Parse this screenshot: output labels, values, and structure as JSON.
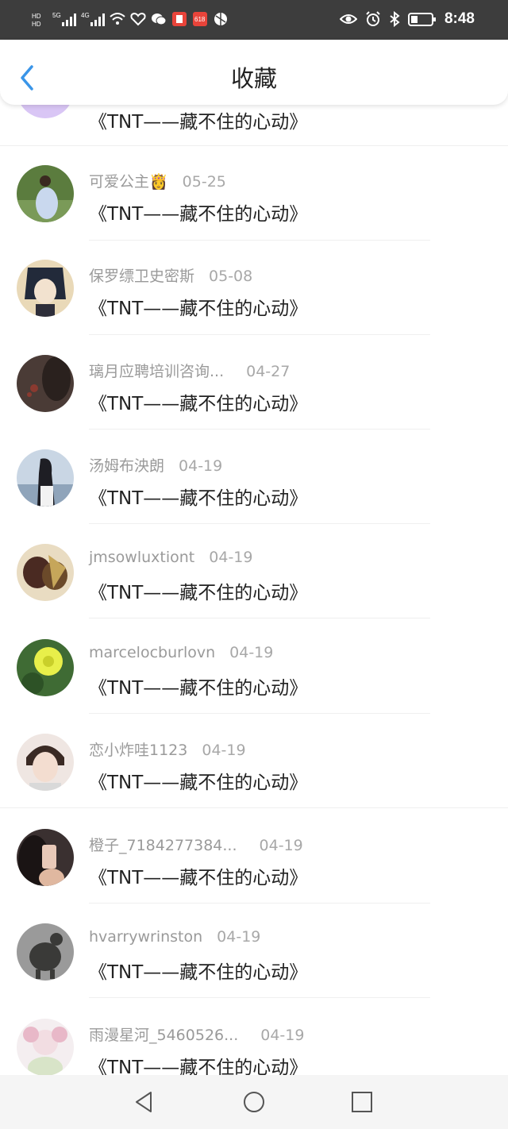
{
  "status_bar": {
    "time": "8:48",
    "left_icons": [
      "hd-icon",
      "5g-signal-icon",
      "4g-signal-icon",
      "wifi-icon",
      "health-icon",
      "wechat-icon",
      "red-app-icon",
      "618-app-icon",
      "ball-app-icon"
    ],
    "right_icons": [
      "eye-icon",
      "alarm-icon",
      "bluetooth-icon",
      "battery-icon"
    ]
  },
  "header": {
    "title": "收藏",
    "back_icon": "chevron-left-icon",
    "accent_color": "#3a95e8"
  },
  "favorites": {
    "partial_top_message": "《TNT——藏不住的心动》",
    "items": [
      {
        "name": "可爱公主👸",
        "date": "05-25",
        "message": "《TNT——藏不住的心动》"
      },
      {
        "name": "保罗缥卫史密斯",
        "date": "05-08",
        "message": "《TNT——藏不住的心动》"
      },
      {
        "name": "璃月应聘培训咨询...",
        "date": "04-27",
        "message": "《TNT——藏不住的心动》"
      },
      {
        "name": "汤姆布泱朗",
        "date": "04-19",
        "message": "《TNT——藏不住的心动》"
      },
      {
        "name": "jmsowluxtiont",
        "date": "04-19",
        "message": "《TNT——藏不住的心动》"
      },
      {
        "name": "marcelocburlovn",
        "date": "04-19",
        "message": "《TNT——藏不住的心动》"
      },
      {
        "name": "恋小炸哇1123",
        "date": "04-19",
        "message": "《TNT——藏不住的心动》"
      },
      {
        "name": "橙子_7184277384...",
        "date": "04-19",
        "message": "《TNT——藏不住的心动》"
      },
      {
        "name": "hvarrywrinston",
        "date": "04-19",
        "message": "《TNT——藏不住的心动》"
      },
      {
        "name": "雨漫星河_5460526...",
        "date": "04-19",
        "message": "《TNT——藏不住的心动》"
      }
    ]
  },
  "nav_bar": {
    "icons": [
      "back-triangle-icon",
      "home-circle-icon",
      "recents-square-icon"
    ]
  }
}
